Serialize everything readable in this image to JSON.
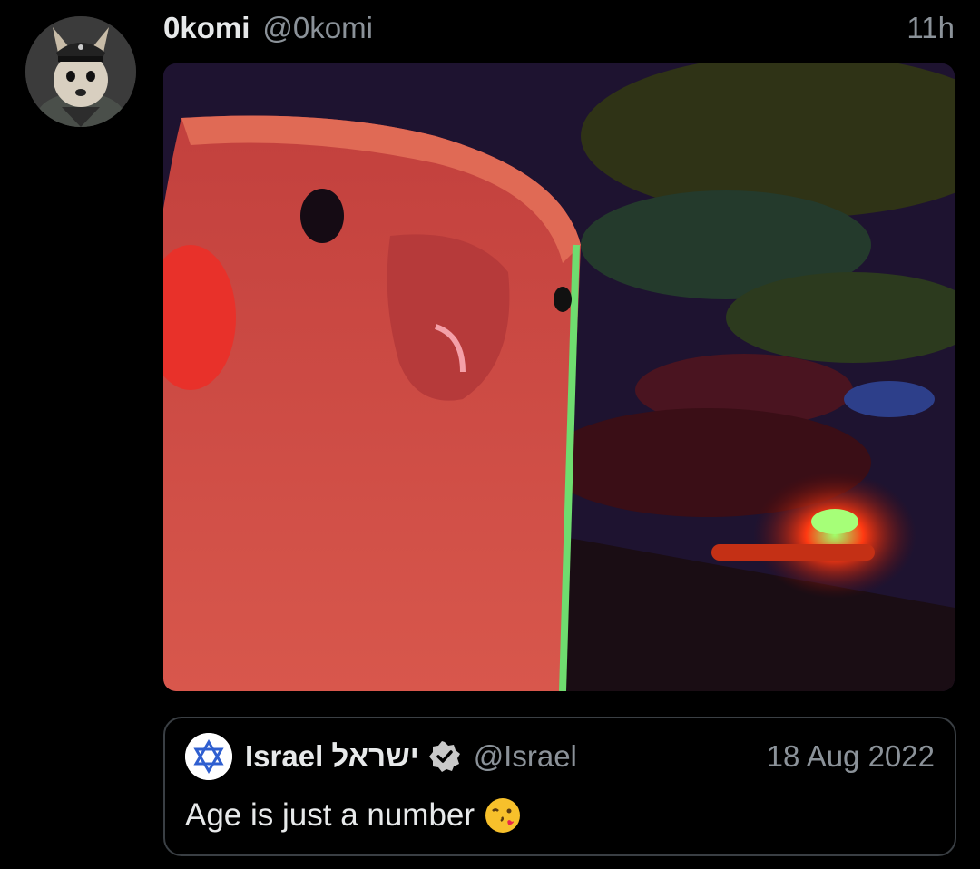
{
  "tweet": {
    "display_name": "0komi",
    "handle": "@0komi",
    "timestamp": "11h",
    "avatar_icon": "avatar-chihuahua-officer",
    "media_icon": "image-parrot-red-explosion"
  },
  "quote": {
    "display_name": "Israel ישראל",
    "handle": "@Israel",
    "date": "18 Aug 2022",
    "text": "Age is just a number",
    "avatar_icon": "star-of-david-icon",
    "verified_icon": "verified-badge-icon",
    "emoji_icon": "face-blowing-kiss-emoji"
  },
  "colors": {
    "background": "#000000",
    "text_primary": "#e7e9ea",
    "text_secondary": "#8b9299",
    "quote_border": "#3a3f44",
    "verified_badge": "#c9c9c9"
  }
}
